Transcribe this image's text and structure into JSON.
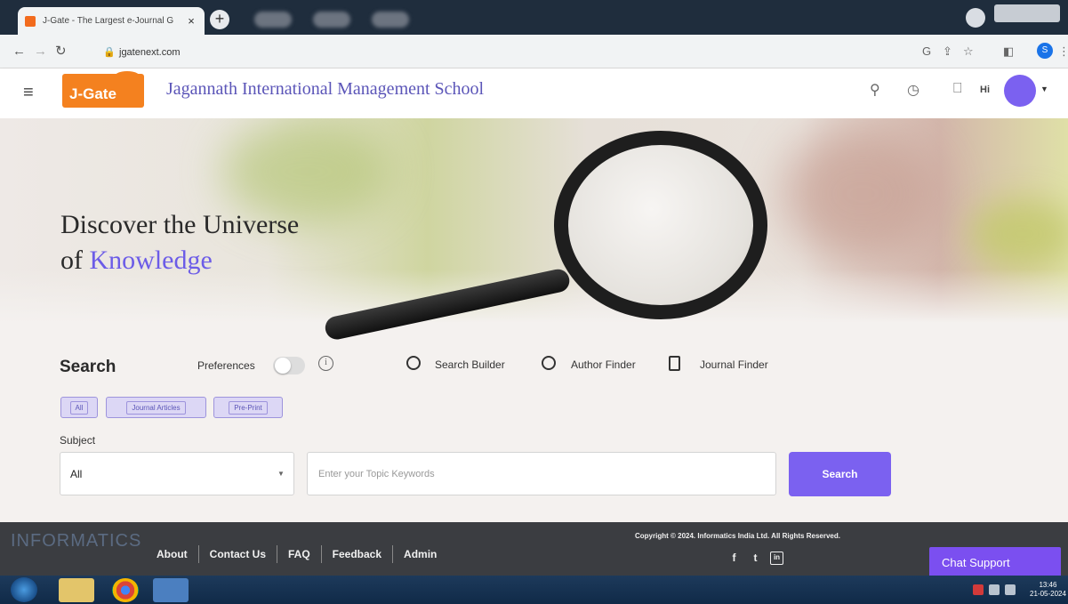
{
  "browser": {
    "tab_title": "J-Gate - The Largest e-Journal G",
    "tab_close": "×",
    "new_tab": "+",
    "url": "jgatenext.com",
    "profile_initial": "S"
  },
  "header": {
    "logo_text": "J-Gate",
    "institution": "Jagannath International Management School",
    "greeting": "Hi",
    "colors": {
      "accent": "#7b61f0",
      "logo": "#f4811f",
      "title": "#5b55b8"
    }
  },
  "hero": {
    "line1": "Discover the Universe",
    "line2_prefix": "of ",
    "line2_accent": "Knowledge"
  },
  "search": {
    "label": "Search",
    "preferences_label": "Preferences",
    "info_glyph": "i",
    "tools": {
      "search_builder": "Search Builder",
      "author_finder": "Author Finder",
      "journal_finder": "Journal Finder"
    },
    "chips": [
      "All",
      "Journal Articles",
      "Pre-Print"
    ],
    "subject_label": "Subject",
    "subject_value": "All",
    "topic_placeholder": "Enter your Topic Keywords",
    "button_label": "Search"
  },
  "footer": {
    "brand": "INFORMATICS",
    "links": [
      "About",
      "Contact Us",
      "FAQ",
      "Feedback",
      "Admin"
    ],
    "copyright": "Copyright © 2024. Informatics India Ltd. All Rights Reserved.",
    "social": {
      "facebook": "f",
      "twitter": "t",
      "linkedin": "in"
    },
    "chat_support": "Chat Support"
  },
  "taskbar": {
    "time": "13:46",
    "date": "21-05-2024"
  }
}
